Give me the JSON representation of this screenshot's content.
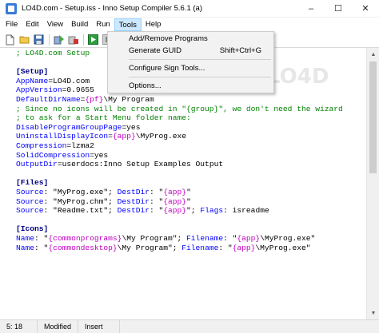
{
  "window": {
    "title": "LO4D.com - Setup.iss - Inno Setup Compiler 5.6.1 (a)",
    "minimize_glyph": "–",
    "maximize_glyph": "☐",
    "close_glyph": "✕"
  },
  "menubar": {
    "items": [
      "File",
      "Edit",
      "View",
      "Build",
      "Run",
      "Tools",
      "Help"
    ],
    "active": "Tools"
  },
  "tools_menu": {
    "items": [
      {
        "label": "Add/Remove Programs",
        "shortcut": ""
      },
      {
        "label": "Generate GUID",
        "shortcut": "Shift+Ctrl+G"
      },
      {
        "label": "Configure Sign Tools...",
        "shortcut": ""
      },
      {
        "label": "Options...",
        "shortcut": ""
      }
    ]
  },
  "editor": {
    "lines": [
      [
        {
          "t": "; LO4D.com Setup",
          "c": "c-comment"
        }
      ],
      [],
      [
        {
          "t": "[Setup]",
          "c": "c-section"
        }
      ],
      [
        {
          "t": "AppName",
          "c": "c-key"
        },
        {
          "t": "=LO4D.com",
          "c": "c-val"
        }
      ],
      [
        {
          "t": "AppVersion",
          "c": "c-key"
        },
        {
          "t": "=0.9655",
          "c": "c-val"
        }
      ],
      [
        {
          "t": "DefaultDirName",
          "c": "c-key"
        },
        {
          "t": "=",
          "c": "c-val"
        },
        {
          "t": "{pf}",
          "c": "c-const"
        },
        {
          "t": "\\My Program",
          "c": "c-val"
        }
      ],
      [
        {
          "t": "; Since no icons will be created in \"{group}\", we don't need the wizard",
          "c": "c-comment"
        }
      ],
      [
        {
          "t": "; to ask for a Start Menu folder name:",
          "c": "c-comment"
        }
      ],
      [
        {
          "t": "DisableProgramGroupPage",
          "c": "c-key"
        },
        {
          "t": "=yes",
          "c": "c-val"
        }
      ],
      [
        {
          "t": "UninstallDisplayIcon",
          "c": "c-key"
        },
        {
          "t": "=",
          "c": "c-val"
        },
        {
          "t": "{app}",
          "c": "c-const"
        },
        {
          "t": "\\MyProg.exe",
          "c": "c-val"
        }
      ],
      [
        {
          "t": "Compression",
          "c": "c-key"
        },
        {
          "t": "=lzma2",
          "c": "c-val"
        }
      ],
      [
        {
          "t": "SolidCompression",
          "c": "c-key"
        },
        {
          "t": "=yes",
          "c": "c-val"
        }
      ],
      [
        {
          "t": "OutputDir",
          "c": "c-key"
        },
        {
          "t": "=userdocs:Inno Setup Examples Output",
          "c": "c-val"
        }
      ],
      [],
      [
        {
          "t": "[Files]",
          "c": "c-section"
        }
      ],
      [
        {
          "t": "Source",
          "c": "c-param"
        },
        {
          "t": ": \"MyProg.exe\"; ",
          "c": "c-val"
        },
        {
          "t": "DestDir",
          "c": "c-param"
        },
        {
          "t": ": \"",
          "c": "c-val"
        },
        {
          "t": "{app}",
          "c": "c-const"
        },
        {
          "t": "\"",
          "c": "c-val"
        }
      ],
      [
        {
          "t": "Source",
          "c": "c-param"
        },
        {
          "t": ": \"MyProg.chm\"; ",
          "c": "c-val"
        },
        {
          "t": "DestDir",
          "c": "c-param"
        },
        {
          "t": ": \"",
          "c": "c-val"
        },
        {
          "t": "{app}",
          "c": "c-const"
        },
        {
          "t": "\"",
          "c": "c-val"
        }
      ],
      [
        {
          "t": "Source",
          "c": "c-param"
        },
        {
          "t": ": \"Readme.txt\"; ",
          "c": "c-val"
        },
        {
          "t": "DestDir",
          "c": "c-param"
        },
        {
          "t": ": \"",
          "c": "c-val"
        },
        {
          "t": "{app}",
          "c": "c-const"
        },
        {
          "t": "\"; ",
          "c": "c-val"
        },
        {
          "t": "Flags",
          "c": "c-param"
        },
        {
          "t": ": isreadme",
          "c": "c-val"
        }
      ],
      [],
      [
        {
          "t": "[Icons]",
          "c": "c-section"
        }
      ],
      [
        {
          "t": "Name",
          "c": "c-param"
        },
        {
          "t": ": \"",
          "c": "c-val"
        },
        {
          "t": "{commonprograms}",
          "c": "c-const"
        },
        {
          "t": "\\My Program\"; ",
          "c": "c-val"
        },
        {
          "t": "Filename",
          "c": "c-param"
        },
        {
          "t": ": \"",
          "c": "c-val"
        },
        {
          "t": "{app}",
          "c": "c-const"
        },
        {
          "t": "\\MyProg.exe\"",
          "c": "c-val"
        }
      ],
      [
        {
          "t": "Name",
          "c": "c-param"
        },
        {
          "t": ": \"",
          "c": "c-val"
        },
        {
          "t": "{commondesktop}",
          "c": "c-const"
        },
        {
          "t": "\\My Program\"; ",
          "c": "c-val"
        },
        {
          "t": "Filename",
          "c": "c-param"
        },
        {
          "t": ": \"",
          "c": "c-val"
        },
        {
          "t": "{app}",
          "c": "c-const"
        },
        {
          "t": "\\MyProg.exe\"",
          "c": "c-val"
        }
      ]
    ]
  },
  "statusbar": {
    "position": "5:  18",
    "modified": "Modified",
    "mode": "Insert"
  },
  "watermark": {
    "text": "LO4D"
  },
  "colors": {
    "comment": "#008000",
    "section": "#000080",
    "key": "#0000ff",
    "constant": "#c000c0",
    "menu_highlight": "#cce8ff"
  }
}
